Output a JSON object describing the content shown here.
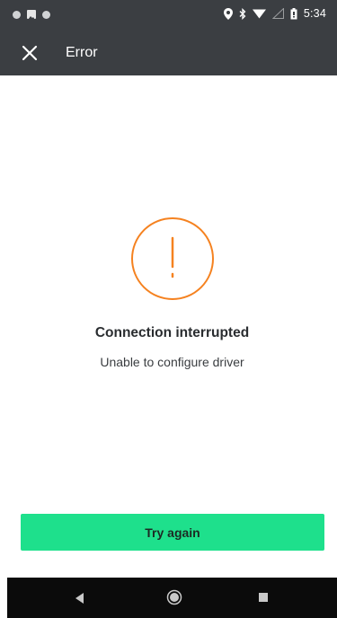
{
  "status_bar": {
    "time": "5:34",
    "icons": [
      "notification-dot-icon",
      "image-icon",
      "notification-dot-icon",
      "location-icon",
      "bluetooth-icon",
      "wifi-icon",
      "signal-icon",
      "battery-icon"
    ]
  },
  "app_bar": {
    "title": "Error",
    "close_icon": "close-icon"
  },
  "main": {
    "icon": "alert-circle-icon",
    "accent_color": "#f58220",
    "headline": "Connection interrupted",
    "message": "Unable to configure driver"
  },
  "actions": {
    "retry_label": "Try again",
    "button_color": "#1ee08c"
  },
  "nav_bar": {
    "icons": [
      "back-icon",
      "home-icon",
      "recents-icon"
    ]
  }
}
